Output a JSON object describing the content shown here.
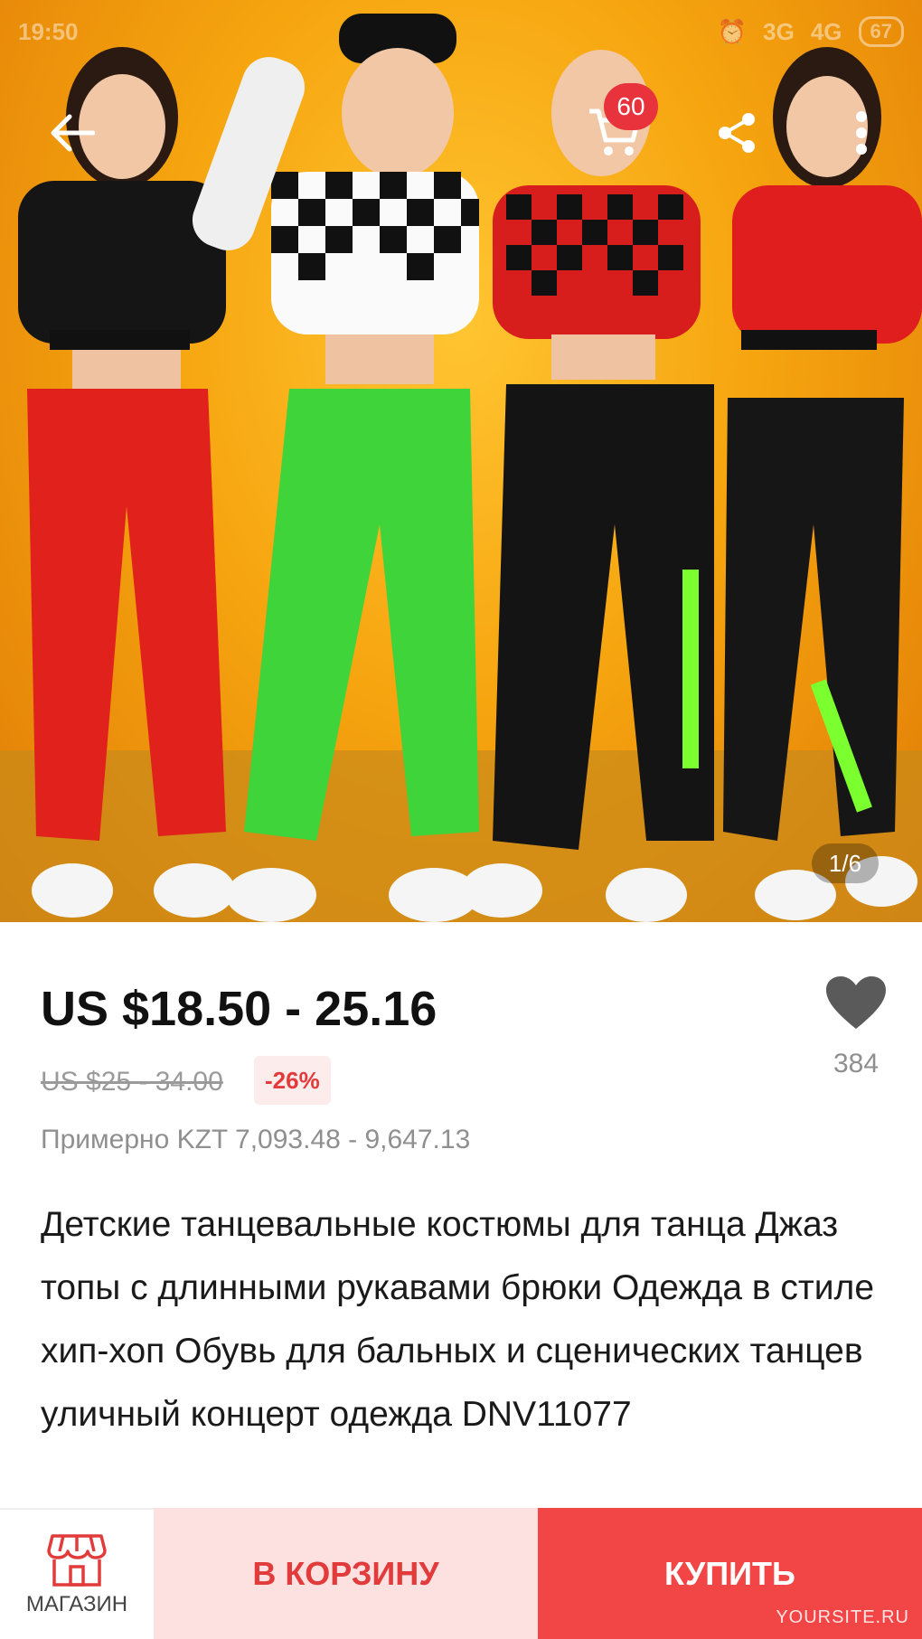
{
  "status_bar": {
    "time": "19:50",
    "signal": "3G",
    "signal2": "4G",
    "battery": "67"
  },
  "gallery": {
    "cart_count": "60",
    "page_indicator": "1/6"
  },
  "product": {
    "price": "US $18.50 - 25.16",
    "original_price": "US $25 - 34.00",
    "discount": "-26%",
    "approx_price": "Примерно KZT 7,093.48 - 9,647.13",
    "wishlist_count": "384",
    "title": "Детские танцевальные костюмы для танца Джаз топы с длинными рукавами брюки Одежда в стиле хип-хоп Обувь для бальных и сценических танцев уличный концерт одежда DNV11077"
  },
  "bottom_bar": {
    "store_label": "МАГАЗИН",
    "add_to_cart_label": "В КОРЗИНУ",
    "buy_label": "КУПИТЬ",
    "watermark": "YOURSITE.RU"
  },
  "colors": {
    "accent": "#f24646",
    "discount_bg": "#fdecec",
    "cart_bg": "#fde0e0"
  }
}
